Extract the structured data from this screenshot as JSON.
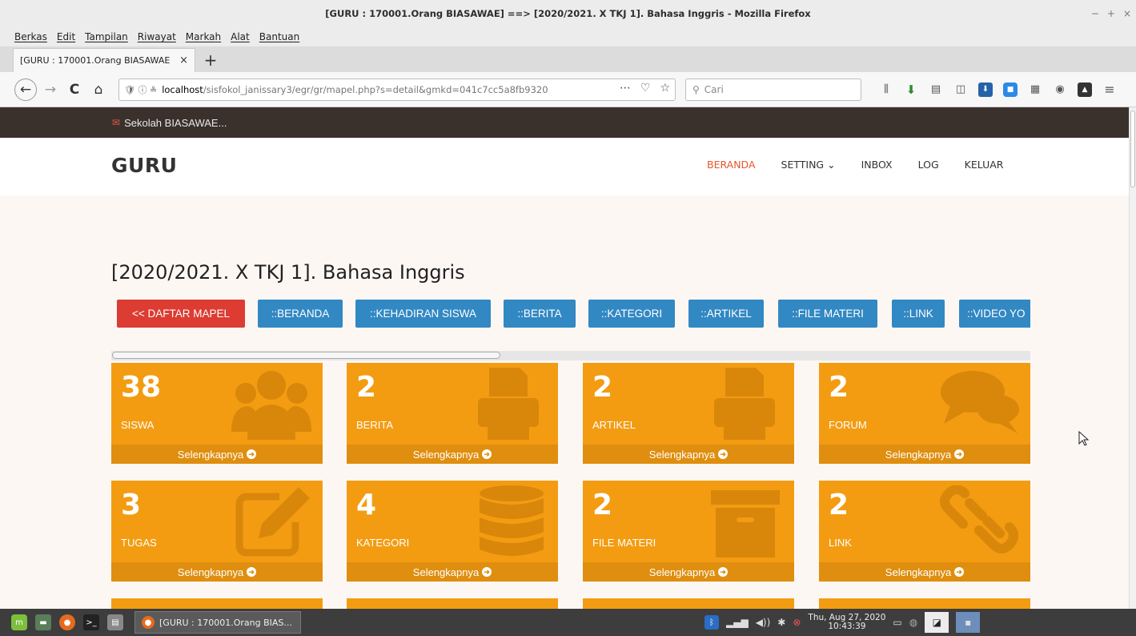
{
  "window": {
    "title": "[GURU : 170001.Orang BIASAWAE] ==> [2020/2021. X TKJ 1]. Bahasa Inggris - Mozilla Firefox",
    "controls": [
      "−",
      "+",
      "×"
    ]
  },
  "menubar": [
    "Berkas",
    "Edit",
    "Tampilan",
    "Riwayat",
    "Markah",
    "Alat",
    "Bantuan"
  ],
  "tabs": [
    {
      "title": "[GURU : 170001.Orang BIASAWAE",
      "close": "×"
    }
  ],
  "newtab": "+",
  "nav": {
    "back": "←",
    "forward": "→",
    "reload": "C",
    "home": "⌂",
    "url_icons": "🛡 ⓘ ≗",
    "url_host": "localhost",
    "url_path": "/sisfokol_janissary3/egr/gr/mapel.php?s=detail&gmkd=041c7cc5a8fb9320",
    "url_tools": [
      "⋯",
      "♡",
      "☆"
    ],
    "search_placeholder": "Cari"
  },
  "site": {
    "top_strip_icon": "✉",
    "top_strip_text": "Sekolah BIASAWAE...",
    "brand": "GURU",
    "nav": [
      "BERANDA",
      "SETTING",
      "INBOX",
      "LOG",
      "KELUAR"
    ],
    "nav_active": "BERANDA",
    "setting_chevron": "⌄"
  },
  "page": {
    "title": "[2020/2021. X TKJ 1]. Bahasa Inggris",
    "buttons": [
      {
        "label": "<< DAFTAR MAPEL",
        "color": "#dc3c31"
      },
      {
        "label": "::BERANDA",
        "color": "#3288c3"
      },
      {
        "label": "::KEHADIRAN SISWA",
        "color": "#3288c3"
      },
      {
        "label": "::BERITA",
        "color": "#3288c3"
      },
      {
        "label": "::KATEGORI",
        "color": "#3288c3"
      },
      {
        "label": "::ARTIKEL",
        "color": "#3288c3"
      },
      {
        "label": "::FILE MATERI",
        "color": "#3288c3"
      },
      {
        "label": "::LINK",
        "color": "#3288c3"
      },
      {
        "label": "::VIDEO YO",
        "color": "#3288c3"
      }
    ],
    "cards": [
      {
        "number": "38",
        "label": "SISWA",
        "icon": "users-icon",
        "footer": "Selengkapnya"
      },
      {
        "number": "2",
        "label": "BERITA",
        "icon": "printer-icon",
        "footer": "Selengkapnya"
      },
      {
        "number": "2",
        "label": "ARTIKEL",
        "icon": "printer-icon",
        "footer": "Selengkapnya"
      },
      {
        "number": "2",
        "label": "FORUM",
        "icon": "comments-icon",
        "footer": "Selengkapnya"
      },
      {
        "number": "3",
        "label": "TUGAS",
        "icon": "edit-icon",
        "footer": "Selengkapnya"
      },
      {
        "number": "4",
        "label": "KATEGORI",
        "icon": "database-icon",
        "footer": "Selengkapnya"
      },
      {
        "number": "2",
        "label": "FILE MATERI",
        "icon": "archive-icon",
        "footer": "Selengkapnya"
      },
      {
        "number": "2",
        "label": "LINK",
        "icon": "link-icon",
        "footer": "Selengkapnya"
      }
    ],
    "card_color": "#f39c12",
    "footer_arrow": "➜"
  },
  "taskbar": {
    "task_title": "[GURU : 170001.Orang BIAS...",
    "clock_line1": "Thu, Aug 27, 2020",
    "clock_line2": "10:43:39"
  }
}
